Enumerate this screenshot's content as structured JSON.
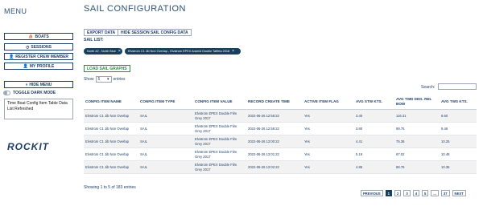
{
  "sidebar": {
    "title": "MENU",
    "buttons": [
      {
        "label": "BOATS",
        "icon": "boat-icon"
      },
      {
        "label": "SESSIONS",
        "icon": "clock-icon"
      },
      {
        "label": "REGISTER CREW MEMBER",
        "icon": "user-add-icon"
      },
      {
        "label": "MY PROFILE",
        "icon": "user-icon"
      },
      {
        "label": "HIDE MENU",
        "icon": "double-chevron-left-icon"
      }
    ],
    "toggle_label": "TOGGLE DARK MODE",
    "notice": "Time Boat Config Item Table Data List Refreshed",
    "logo": "ROCKIT"
  },
  "main": {
    "title": "SAIL CONFIGURATION",
    "export_label": "EXPORT DATA",
    "hide_session_label": "HIDE SESSION SAIL CONFIG DATA",
    "sail_list_label": "SAIL LIST:",
    "chips": [
      "North #2 - North Blue",
      "Elvstrom C1 Jib Non Overlap - Elvstrom EPEX Aramid Double Taffeta 2018"
    ],
    "load_graphs_label": "LOAD SAIL GRAPHS",
    "show_prefix": "Show",
    "show_value": "5",
    "show_suffix": "entries",
    "search_label": "Search:",
    "search_value": "",
    "table": {
      "headers": [
        "CONFIG ITEM NAME",
        "CONFIG ITEM TYPE",
        "CONFIG ITEM VALUE",
        "RECORD CREATE TIME",
        "ACTIVE ITEM FLAG",
        "AVG STW KTS.",
        "AVG TWD DEG. REL BOW",
        "AVG TWS KTS."
      ],
      "rows": [
        [
          "Elvstrom C1 Jib Non Overlap",
          "SAIL",
          "Elvstrom EPEX Double Film Grey 2017",
          "2022-06-26 12:58:22",
          "Yes",
          "3.40",
          "116.31",
          "6.60"
        ],
        [
          "Elvstrom C1 Jib Non Overlap",
          "SAIL",
          "Elvstrom EPEX Double Film Grey 2017",
          "2022-06-26 12:59:22",
          "Yes",
          "3.80",
          "99.75",
          "9.46"
        ],
        [
          "Elvstrom C1 Jib Non Overlap",
          "SAIL",
          "Elvstrom EPEX Double Film Grey 2017",
          "2022-06-26 13:00:22",
          "Yes",
          "4.41",
          "75.36",
          "10.25"
        ],
        [
          "Elvstrom C1 Jib Non Overlap",
          "SAIL",
          "Elvstrom EPEX Double Film Grey 2017",
          "2022-06-26 13:01:22",
          "Yes",
          "5.19",
          "67.02",
          "10.48"
        ],
        [
          "Elvstrom C1 Jib Non Overlap",
          "SAIL",
          "Elvstrom EPEX Double Film Grey 2017",
          "2022-06-26 13:02:22",
          "Yes",
          "4.85",
          "88.76",
          "10.35"
        ]
      ]
    },
    "info": "Showing 1 to 5 of 183 entries",
    "pagination": [
      "PREVIOUS",
      "1",
      "2",
      "3",
      "4",
      "5",
      "...",
      "37",
      "NEXT"
    ]
  }
}
